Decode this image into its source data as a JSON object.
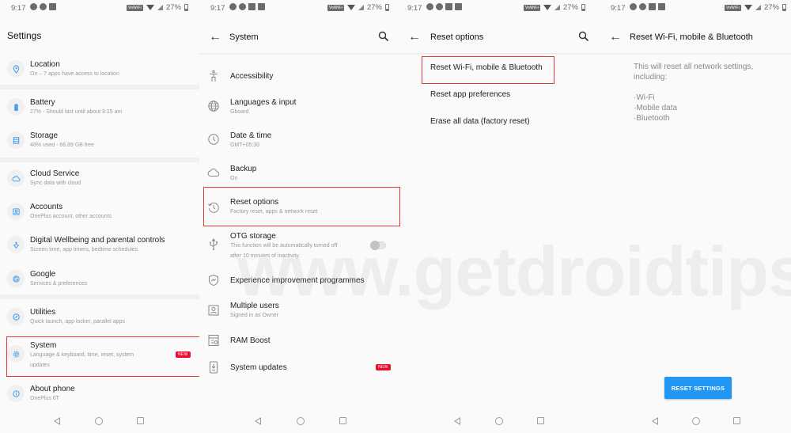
{
  "status_bar": {
    "time": "9:17",
    "vowifi": "VoWiFi",
    "battery": "27%"
  },
  "panel1": {
    "title": "Settings",
    "items": [
      {
        "title": "Location",
        "subtitle": "On – 7 apps have access to location",
        "icon": "location-pin-icon"
      },
      {
        "title": "Battery",
        "subtitle": "27% - Should last until about 9:15 am",
        "icon": "battery-icon"
      },
      {
        "title": "Storage",
        "subtitle": "48% used - 66.89 GB free",
        "icon": "storage-icon"
      },
      {
        "title": "Cloud Service",
        "subtitle": "Sync data with cloud",
        "icon": "cloud-icon"
      },
      {
        "title": "Accounts",
        "subtitle": "OnePlus account, other accounts",
        "icon": "account-icon"
      },
      {
        "title": "Digital Wellbeing and parental controls",
        "subtitle": "Screen time, app timers, bedtime schedules",
        "icon": "wellbeing-icon"
      },
      {
        "title": "Google",
        "subtitle": "Services & preferences",
        "icon": "google-icon"
      },
      {
        "title": "Utilities",
        "subtitle": "Quick launch, app locker, parallel apps",
        "icon": "utilities-icon"
      },
      {
        "title": "System",
        "subtitle": "Language & keyboard, time, reset, system",
        "subtitle2": "updates",
        "badge": "NEW",
        "icon": "gear-icon"
      },
      {
        "title": "About phone",
        "subtitle": "OnePlus 6T",
        "icon": "info-icon"
      }
    ]
  },
  "panel2": {
    "title": "System",
    "items": [
      {
        "title": "Accessibility",
        "icon": "accessibility-icon"
      },
      {
        "title": "Languages & input",
        "subtitle": "Gboard",
        "icon": "globe-icon"
      },
      {
        "title": "Date & time",
        "subtitle": "GMT+05:30",
        "icon": "clock-icon"
      },
      {
        "title": "Backup",
        "subtitle": "On",
        "icon": "cloud-icon"
      },
      {
        "title": "Reset options",
        "subtitle": "Factory reset, apps & network reset",
        "icon": "history-icon"
      },
      {
        "title": "OTG storage",
        "subtitle": "This function will be automatically turned off",
        "subtitle2": "after 10 minutes of inactivity.",
        "icon": "usb-icon",
        "toggle_on": false
      },
      {
        "title": "Experience improvement programmes",
        "icon": "shield-icon"
      },
      {
        "title": "Multiple users",
        "subtitle": "Signed in as Owner",
        "icon": "users-icon"
      },
      {
        "title": "RAM Boost",
        "icon": "ram-icon"
      },
      {
        "title": "System updates",
        "badge": "NEW",
        "icon": "system-update-icon"
      }
    ]
  },
  "panel3": {
    "title": "Reset options",
    "items": [
      {
        "title": "Reset Wi-Fi, mobile & Bluetooth"
      },
      {
        "title": "Reset app preferences"
      },
      {
        "title": "Erase all data (factory reset)"
      }
    ]
  },
  "panel4": {
    "title": "Reset Wi-Fi, mobile & Bluetooth",
    "description": "This will reset all network settings, including:",
    "bullets": [
      "·Wi-Fi",
      "·Mobile data",
      "·Bluetooth"
    ],
    "button": "RESET SETTINGS"
  },
  "watermark": "www.getdroidtips.com",
  "colors": {
    "accent": "#2196f3",
    "highlight": "#e53935",
    "badge": "#e8102c",
    "icon": "#4a9fe8"
  }
}
